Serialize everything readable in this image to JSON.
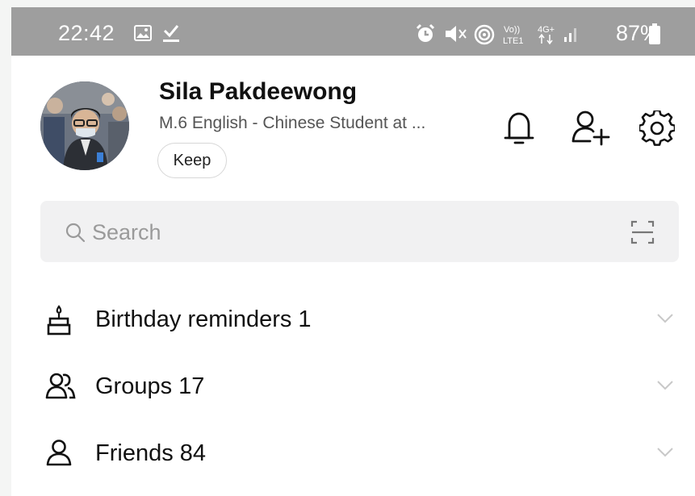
{
  "status_bar": {
    "time": "22:42",
    "battery": "87%",
    "icons": [
      "image-icon",
      "download-check-icon",
      "alarm-icon",
      "mute-icon",
      "hotspot-icon",
      "volte-icon",
      "4g-icon",
      "signal-icon",
      "battery-icon"
    ]
  },
  "profile": {
    "name": "Sila Pakdeewong",
    "status_message": "M.6 English - Chinese Student at ...",
    "keep_label": "Keep"
  },
  "header_actions": [
    "bell-icon",
    "add-friend-icon",
    "settings-icon"
  ],
  "search": {
    "placeholder": "Search"
  },
  "sections": [
    {
      "label": "Birthday reminders 1",
      "icon": "cake-icon"
    },
    {
      "label": "Groups 17",
      "icon": "group-icon"
    },
    {
      "label": "Friends 84",
      "icon": "person-icon"
    }
  ],
  "colors": {
    "status_bar_bg": "#9e9e9e",
    "search_bg": "#f1f1f2",
    "text_primary": "#111111",
    "text_secondary": "#555555"
  }
}
